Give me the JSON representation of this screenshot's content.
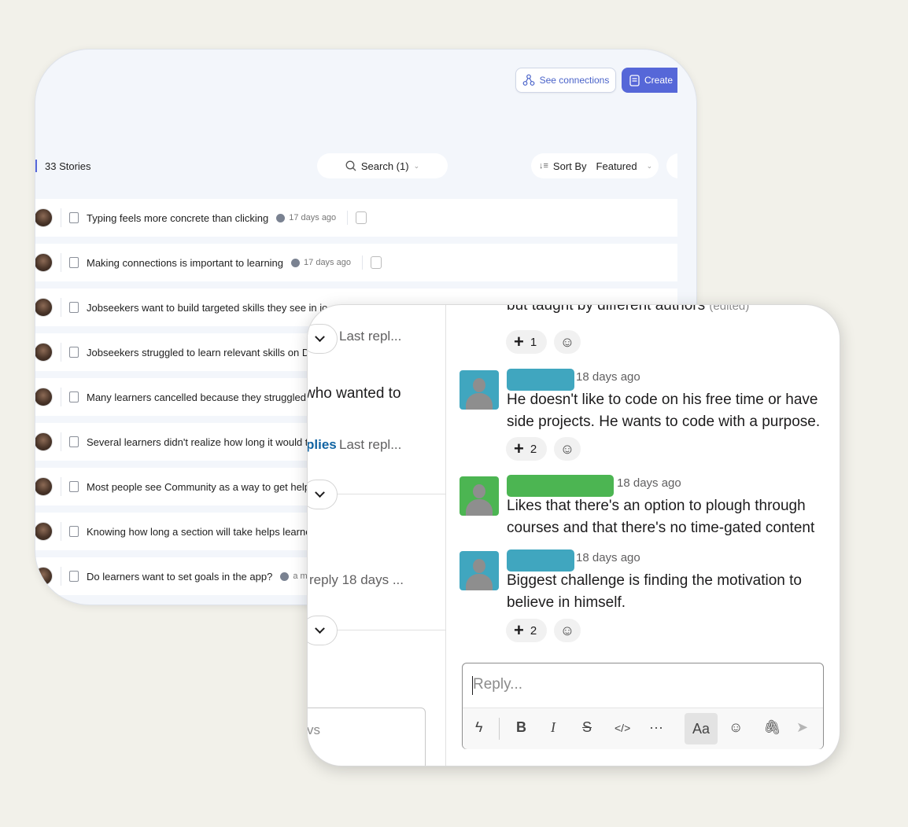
{
  "back_window": {
    "see_connections": "See connections",
    "create": "Create",
    "stories_count": "33 Stories",
    "search": "Search (1)",
    "sort_label": "Sort By",
    "sort_value": "Featured",
    "rows": [
      {
        "title": "Typing feels more concrete than clicking",
        "ago": "17 days ago"
      },
      {
        "title": "Making connections is important to learning",
        "ago": "17 days ago"
      },
      {
        "title": "Jobseekers want to build targeted skills they see in jo",
        "ago": ""
      },
      {
        "title": "Jobseekers struggled to learn relevant skills on D",
        "ago": ""
      },
      {
        "title": "Many learners cancelled because they struggled t",
        "ago": ""
      },
      {
        "title": "Several learners didn't realize how long it would t",
        "ago": ""
      },
      {
        "title": "Most people see Community as a way to get help",
        "ago": ""
      },
      {
        "title": "Knowing how long a section will take helps learne",
        "ago": ""
      },
      {
        "title": "Do learners want to set goals in the app?",
        "ago": "a mo"
      }
    ]
  },
  "front_window": {
    "left_pane": {
      "last_reply_1": "Last repl...",
      "who_wanted": "who wanted to",
      "replies_link": "plies",
      "last_reply_2": "Last repl...",
      "reply_18": "reply 18 days ...",
      "input_fragment": "vs"
    },
    "top_clipped": {
      "text": "but taught by different authors",
      "edited": "(edited)"
    },
    "top_reaction_count": "1",
    "messages": [
      {
        "time": "18 days ago",
        "text": "He doesn't like to code on his free time or have side projects. He wants to code with a purpose.",
        "reaction_count": "2",
        "name_color": "#40a6bf",
        "avatar_color": "#40a6bf"
      },
      {
        "time": "18 days ago",
        "text": "Likes that there's an option to plough through courses and that there's no time-gated content",
        "reaction_count": "",
        "name_color": "#4cb552",
        "avatar_color": "#4cb552"
      },
      {
        "time": "18 days ago",
        "text": "Biggest challenge is finding the motivation to believe in himself.",
        "reaction_count": "2",
        "name_color": "#40a6bf",
        "avatar_color": "#40a6bf"
      }
    ],
    "composer": {
      "placeholder": "Reply...",
      "format_label": "Aa"
    }
  }
}
